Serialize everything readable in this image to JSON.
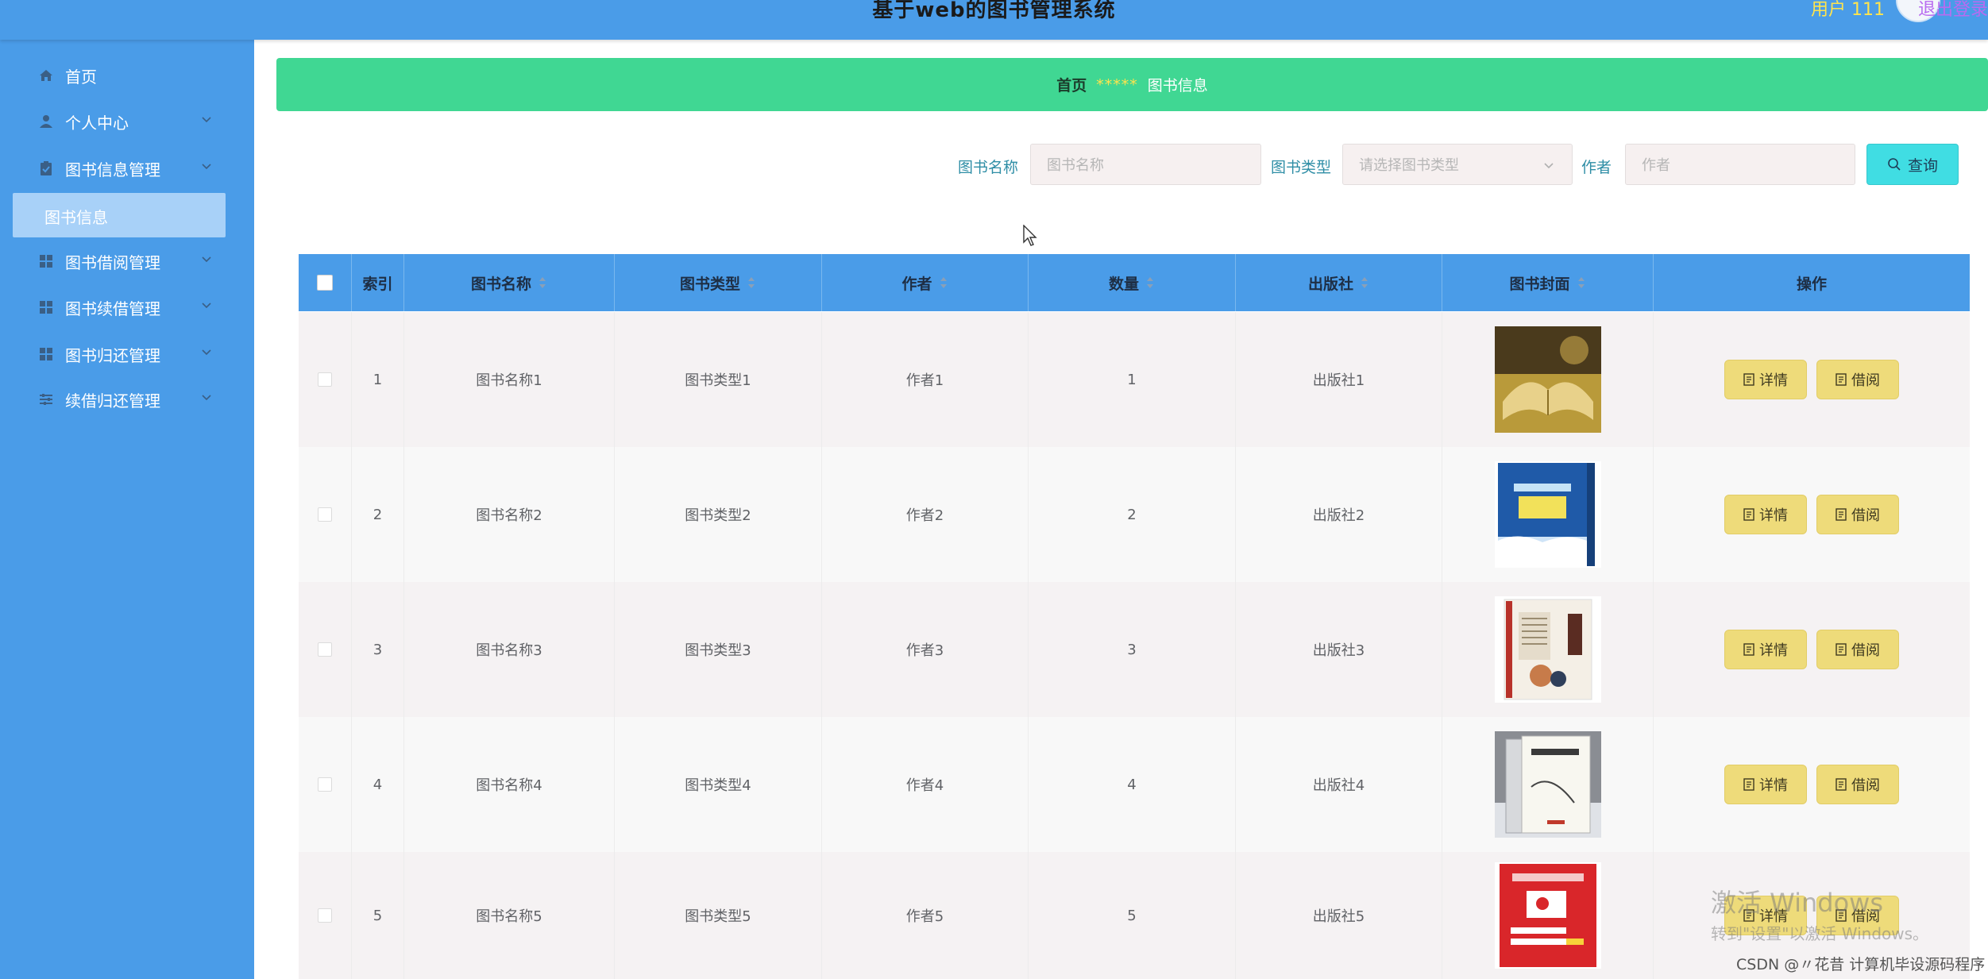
{
  "header": {
    "title": "基于web的图书管理系统",
    "user": "用户 111",
    "logout": "退出登录"
  },
  "sidebar": {
    "items": [
      {
        "label": "首页",
        "icon": "home-icon"
      },
      {
        "label": "个人中心",
        "icon": "user-icon"
      },
      {
        "label": "图书信息管理",
        "icon": "clipboard-icon"
      },
      {
        "label": "图书借阅管理",
        "icon": "grid-icon"
      },
      {
        "label": "图书续借管理",
        "icon": "grid-icon"
      },
      {
        "label": "图书归还管理",
        "icon": "grid-icon"
      },
      {
        "label": "续借归还管理",
        "icon": "sliders-icon"
      }
    ],
    "active_sub": "图书信息"
  },
  "breadcrumb": {
    "home": "首页",
    "separator": "*****",
    "current": "图书信息"
  },
  "search": {
    "name_label": "图书名称",
    "name_placeholder": "图书名称",
    "type_label": "图书类型",
    "type_placeholder": "请选择图书类型",
    "author_label": "作者",
    "author_placeholder": "作者",
    "query_button": "查询"
  },
  "table": {
    "headers": [
      "索引",
      "图书名称",
      "图书类型",
      "作者",
      "数量",
      "出版社",
      "图书封面",
      "操作"
    ],
    "rows": [
      {
        "index": "1",
        "name": "图书名称1",
        "type": "图书类型1",
        "author": "作者1",
        "qty": "1",
        "publisher": "出版社1"
      },
      {
        "index": "2",
        "name": "图书名称2",
        "type": "图书类型2",
        "author": "作者2",
        "qty": "2",
        "publisher": "出版社2"
      },
      {
        "index": "3",
        "name": "图书名称3",
        "type": "图书类型3",
        "author": "作者3",
        "qty": "3",
        "publisher": "出版社3"
      },
      {
        "index": "4",
        "name": "图书名称4",
        "type": "图书类型4",
        "author": "作者4",
        "qty": "4",
        "publisher": "出版社4"
      },
      {
        "index": "5",
        "name": "图书名称5",
        "type": "图书类型5",
        "author": "作者5",
        "qty": "5",
        "publisher": "出版社5"
      }
    ],
    "detail_button": "详情",
    "borrow_button": "借阅"
  },
  "overlay": {
    "watermark_title": "激活 Windows",
    "watermark_sub": "转到\"设置\"以激活 Windows。",
    "csdn": "CSDN @〃花昔  计算机毕设源码程序"
  }
}
